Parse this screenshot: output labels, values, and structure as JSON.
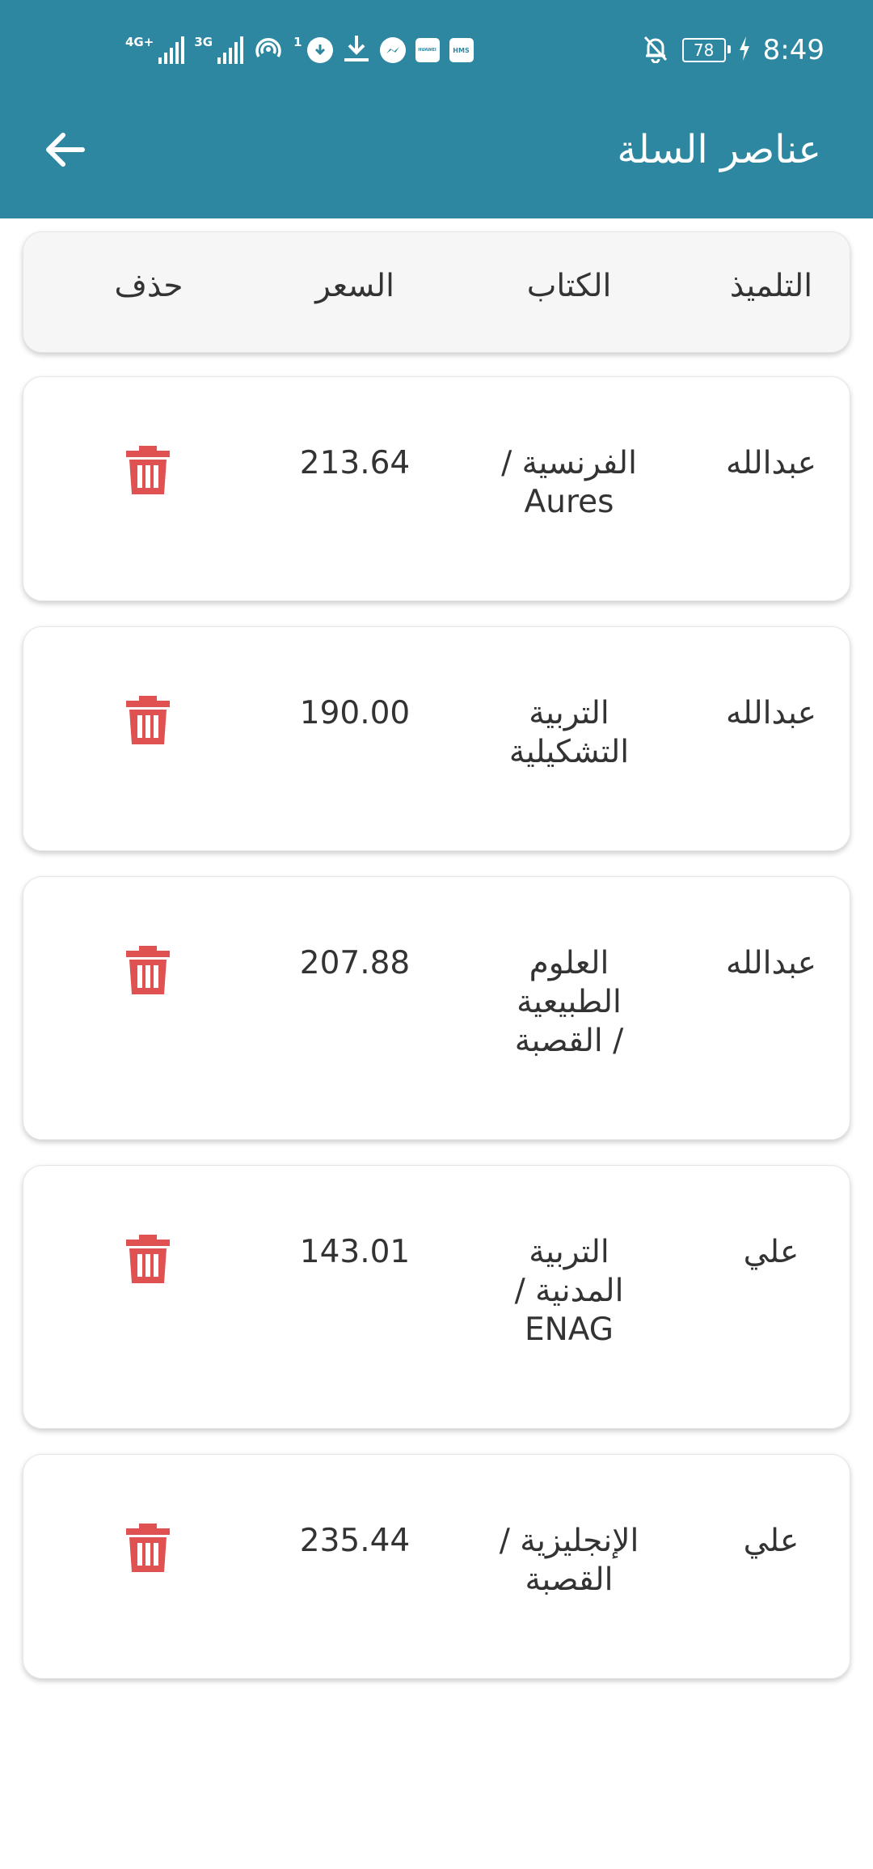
{
  "status_bar": {
    "network_1": "4G+",
    "network_2": "3G",
    "hotspot_count": "1",
    "hms_label": "HMS",
    "huawei_label": "HUAWEI",
    "battery": "78",
    "time": "8:49"
  },
  "app_bar": {
    "title": "عناصر السلة",
    "back_icon": "arrow-left-icon"
  },
  "table": {
    "headers": {
      "student": "التلميذ",
      "book": "الكتاب",
      "price": "السعر",
      "delete": "حذف"
    },
    "rows": [
      {
        "student": "عبدالله",
        "book": "الفرنسية / Aures",
        "price": "213.64"
      },
      {
        "student": "عبدالله",
        "book": "التربية التشكيلية",
        "price": "190.00"
      },
      {
        "student": "عبدالله",
        "book": "العلوم الطبيعية / القصبة",
        "price": "207.88"
      },
      {
        "student": "علي",
        "book": "التربية المدنية / ENAG",
        "price": "143.01"
      },
      {
        "student": "علي",
        "book": "الإنجليزية / القصبة",
        "price": "235.44"
      }
    ]
  },
  "colors": {
    "app_bar": "#2e87a0",
    "delete_icon": "#e05252",
    "header_card": "#f6f6f6"
  }
}
